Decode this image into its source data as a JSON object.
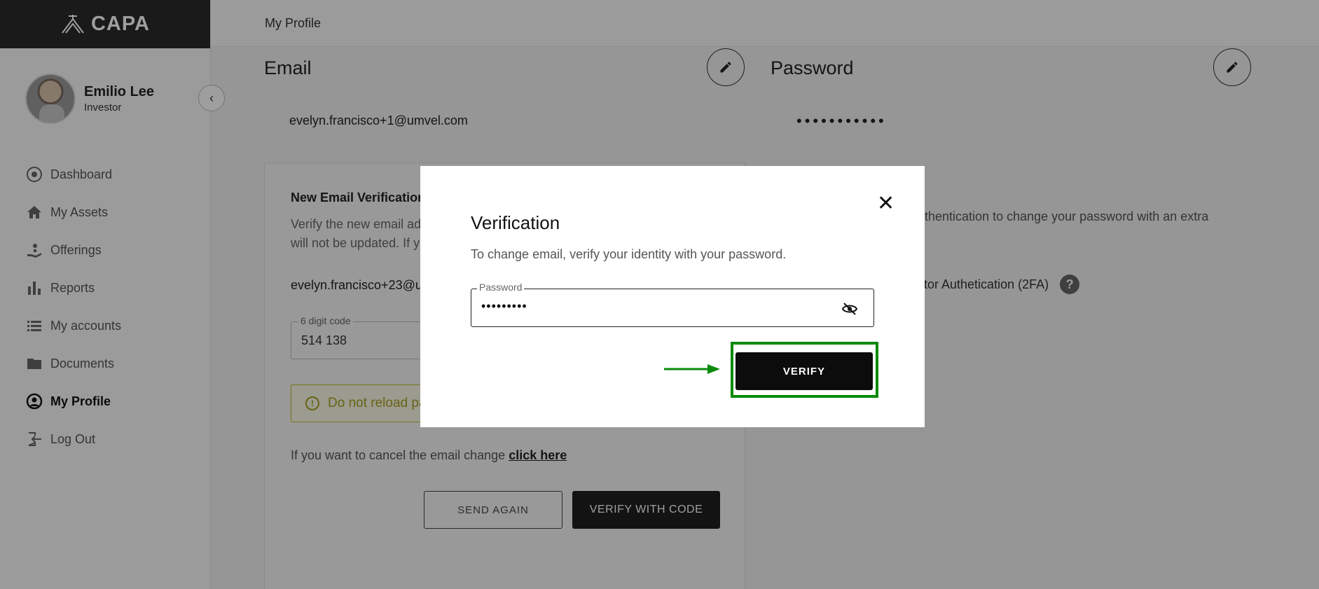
{
  "brand": {
    "name": "CAPA"
  },
  "user": {
    "name": "Emilio Lee",
    "role": "Investor"
  },
  "sidebar": {
    "items": [
      {
        "label": "Dashboard",
        "icon": "dashboard-icon"
      },
      {
        "label": "My Assets",
        "icon": "home-icon"
      },
      {
        "label": "Offerings",
        "icon": "offerings-icon"
      },
      {
        "label": "Reports",
        "icon": "bar-chart-icon"
      },
      {
        "label": "My accounts",
        "icon": "list-icon"
      },
      {
        "label": "Documents",
        "icon": "folder-icon"
      },
      {
        "label": "My Profile",
        "icon": "user-circle-icon",
        "active": true
      },
      {
        "label": "Log Out",
        "icon": "logout-icon"
      }
    ]
  },
  "header": {
    "title": "My Profile"
  },
  "email_section": {
    "title": "Email",
    "current_email": "evelyn.francisco+1@umvel.com",
    "verification_title": "New Email Verification",
    "verification_desc": "Verify the new email ad",
    "verification_desc_line2": "will not be updated. If y",
    "new_email": "evelyn.francisco+23@u",
    "code_label": "6 digit code",
    "code_value": "514 138",
    "warning": "Do not reload pa",
    "cancel_text": "If you want to cancel the email change",
    "cancel_link": "click here",
    "send_again": "SEND AGAIN",
    "verify_with_code": "VERIFY WITH CODE"
  },
  "password_section": {
    "title": "Password",
    "masked": "•••••••••••",
    "twofa_desc": "uthentication to change your password with an extra",
    "twofa_label": "ctor Authetication (2FA)"
  },
  "modal": {
    "title": "Verification",
    "description": "To change email, verify your identity with your password.",
    "password_label": "Password",
    "password_value": "•••••••••",
    "verify_button": "VERIFY",
    "close_symbol": "✕"
  },
  "colors": {
    "sidebar_header": "#2a2a2a",
    "highlight": "#0b8a0b",
    "warning": "#a9a020"
  }
}
